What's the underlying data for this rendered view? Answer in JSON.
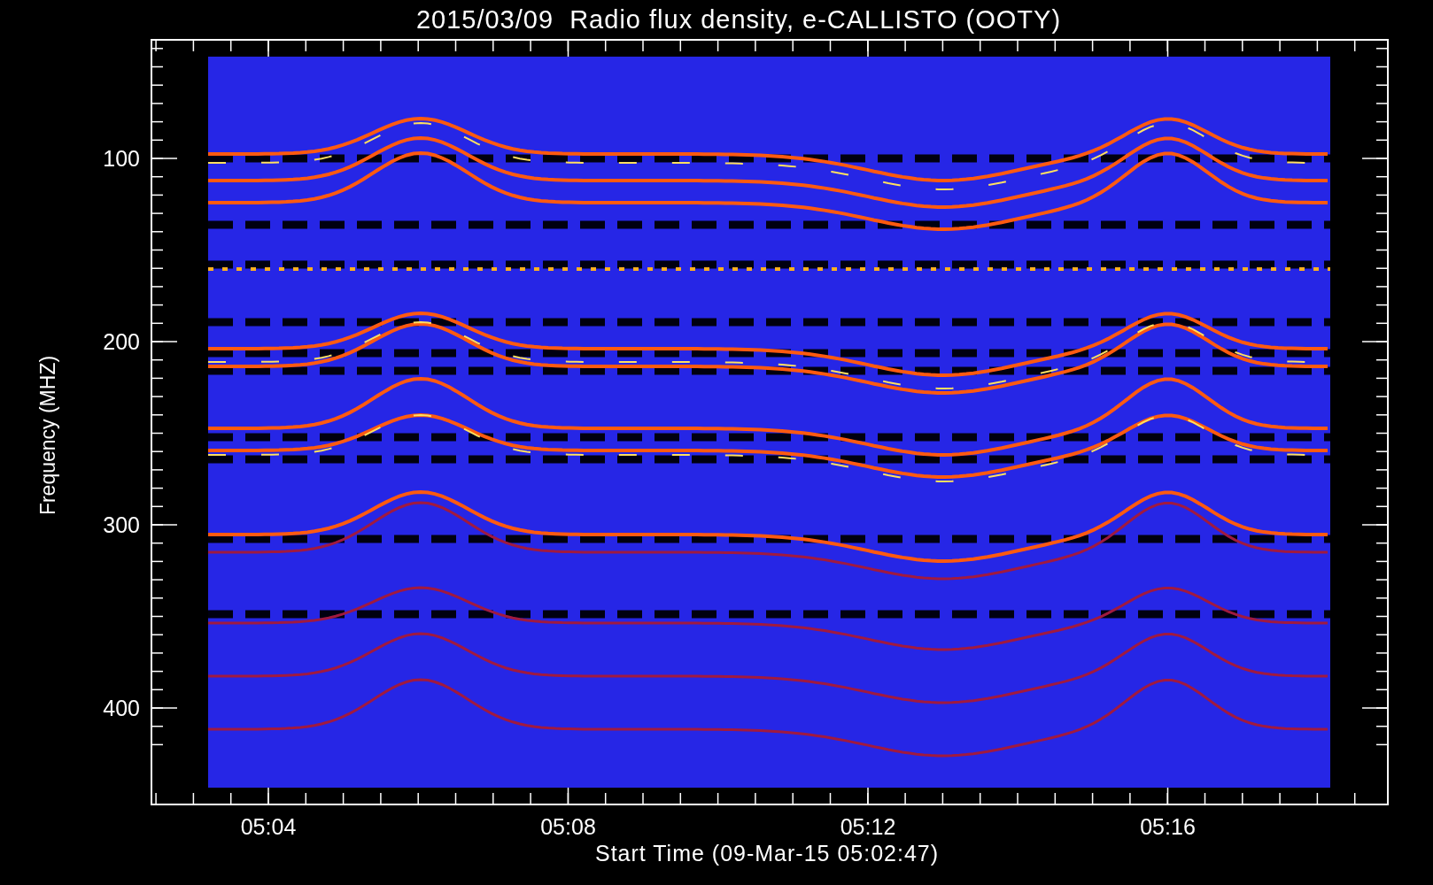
{
  "title": "2015/03/09  Radio flux density, e-CALLISTO (OOTY)",
  "ylabel": "Frequency (MHZ)",
  "xlabel": "Start Time (09-Mar-15 05:02:47)",
  "yticks": [
    "100",
    "200",
    "300",
    "400"
  ],
  "xticks": [
    "05:04",
    "05:08",
    "05:12",
    "05:16"
  ]
}
